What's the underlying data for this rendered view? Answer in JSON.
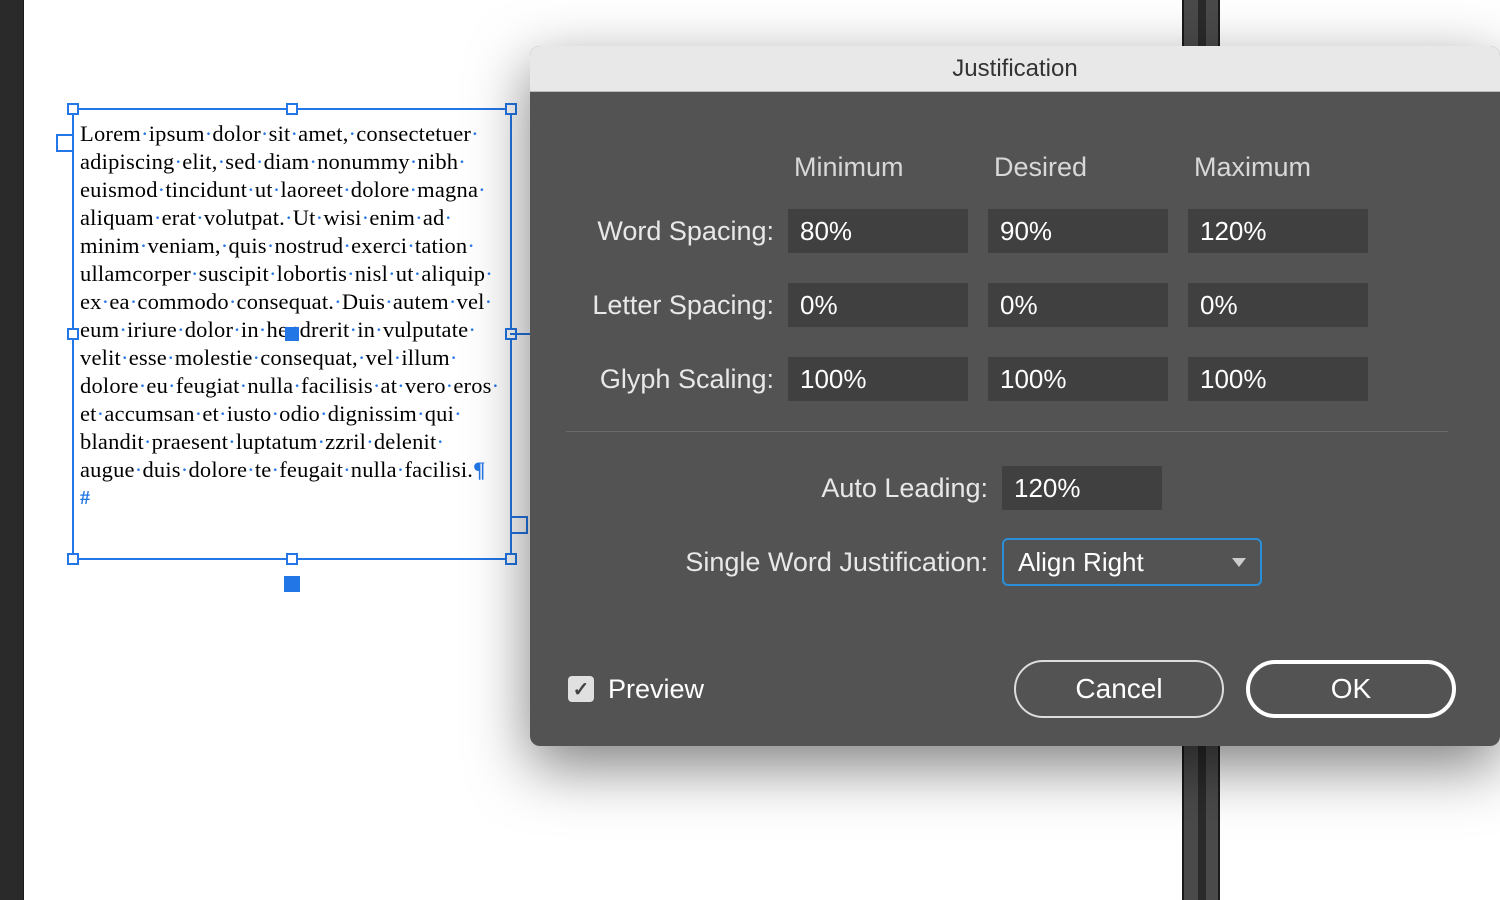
{
  "dialog": {
    "title": "Justification",
    "columns": {
      "min": "Minimum",
      "desired": "Desired",
      "max": "Maximum"
    },
    "wordSpacing": {
      "label": "Word Spacing:",
      "min": "80%",
      "desired": "90%",
      "max": "120%"
    },
    "letterSpacing": {
      "label": "Letter Spacing:",
      "min": "0%",
      "desired": "0%",
      "max": "0%"
    },
    "glyphScaling": {
      "label": "Glyph Scaling:",
      "min": "100%",
      "desired": "100%",
      "max": "100%"
    },
    "autoLeading": {
      "label": "Auto Leading:",
      "value": "120%"
    },
    "singleWord": {
      "label": "Single Word Justification:",
      "value": "Align Right"
    },
    "preview": "Preview",
    "cancel": "Cancel",
    "ok": "OK"
  },
  "textFrame": {
    "lines": [
      "Lorem ipsum dolor sit amet, consectetuer",
      "adipiscing elit, sed diam nonummy nibh",
      "euismod tincidunt ut laoreet dolore magna",
      "aliquam erat volutpat. Ut wisi enim ad",
      "minim veniam, quis nostrud exerci tation",
      "ullamcorper suscipit lobortis nisl ut aliquip",
      "ex ea commodo consequat. Duis autem vel",
      "eum iriure dolor in hendrerit in vulputate",
      "velit esse molestie consequat, vel illum",
      "dolore eu feugiat nulla facilisis at vero eros",
      "et accumsan et iusto odio dignissim qui",
      "blandit praesent luptatum zzril delenit",
      "augue duis dolore te feugait nulla facilisi."
    ]
  }
}
